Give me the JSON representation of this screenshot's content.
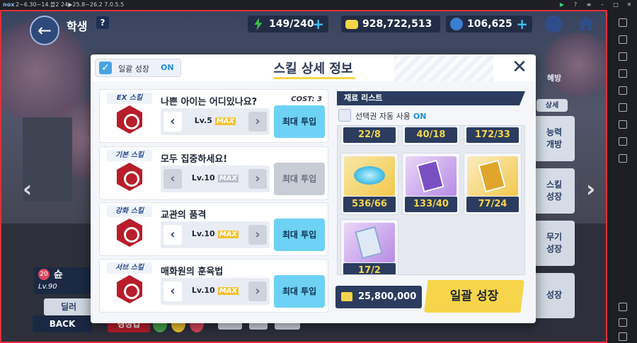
{
  "emulator": {
    "logo": "nox",
    "build": "2~6.30~14.블2 24▶25.8~26.2 7.0.5.5",
    "controls": [
      "▶",
      "?",
      "≡",
      "–",
      "□",
      "✕"
    ]
  },
  "topbar": {
    "title": "학생",
    "help": "?",
    "stamina": "149/240",
    "credits": "928,722,513",
    "gems": "106,625"
  },
  "background": {
    "char_level_badge": "20",
    "char_name": "슌",
    "char_level": "Lv.90",
    "char_button": "딜러",
    "back_label": "BACK",
    "tag_label": "경장갑",
    "right_tabs": [
      "능력\n개방",
      "스킬\n성장",
      "무기\n성장",
      "성장"
    ],
    "right_header": "혜방",
    "right_tab_small": "상세"
  },
  "modal": {
    "bulk_toggle_label": "일괄 성장",
    "bulk_toggle_state": "ON",
    "title": "스킬 상세 정보",
    "close": "✕",
    "skills": [
      {
        "tag": "EX 스킬",
        "name": "나쁜 아이는 어디있나요?",
        "cost": "COST: 3",
        "level": "Lv.5",
        "max": "MAX",
        "button": "최대 투입",
        "enabled": true
      },
      {
        "tag": "기본 스킬",
        "name": "모두 집중하세요!",
        "cost": "",
        "level": "Lv.10",
        "max": "MAX",
        "button": "최대 투입",
        "enabled": false
      },
      {
        "tag": "강화 스킬",
        "name": "교관의 품격",
        "cost": "",
        "level": "Lv.10",
        "max": "MAX",
        "button": "최대 투입",
        "enabled": true
      },
      {
        "tag": "서브 스킬",
        "name": "매화원의 훈육법",
        "cost": "",
        "level": "Lv.10",
        "max": "MAX",
        "button": "최대 투입",
        "enabled": true
      }
    ],
    "materials_header": "재료 리스트",
    "auto_select_label": "선택권 자동 사용",
    "auto_select_state": "ON",
    "materials": [
      {
        "count": "22/8",
        "kind": "partial"
      },
      {
        "count": "40/18",
        "kind": "partial"
      },
      {
        "count": "172/33",
        "kind": "partial"
      },
      {
        "count": "536/66",
        "kind": "disc"
      },
      {
        "count": "133/40",
        "kind": "book-purple"
      },
      {
        "count": "77/24",
        "kind": "book-gold"
      },
      {
        "count": "17/2",
        "kind": "book-blue"
      }
    ],
    "credit_cost": "25,800,000",
    "bulk_growth_button": "일괄 성장"
  },
  "colors": {
    "accent_blue": "#6dd2f3",
    "accent_yellow": "#f6d54a",
    "navy": "#2b3c5f",
    "skill_red": "#b81d2b",
    "frame_red": "#e0303a"
  }
}
